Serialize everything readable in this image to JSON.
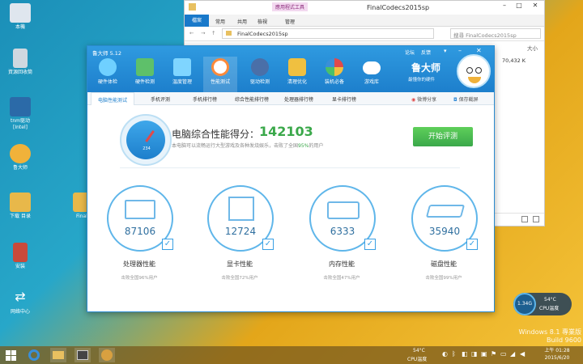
{
  "desktop": {
    "icons": [
      {
        "label": "本機",
        "color": "#dfe6ee"
      },
      {
        "label": "資源回收筒",
        "color": "#cfd8e0"
      },
      {
        "label": "tnm驱动\n[Intel]",
        "color": "#2b6aa8"
      },
      {
        "label": "鲁大师",
        "color": "#f0b23a"
      },
      {
        "label": "下载  目录",
        "color": "#e8b84a"
      },
      {
        "label": "FinalC",
        "color": "#e8b84a"
      },
      {
        "label": "安装",
        "color": "#c94a3a"
      },
      {
        "label": "网络中心",
        "color": "#e0e6ec"
      }
    ],
    "watermark": {
      "line1": "Windows 8.1 專業版",
      "line2": "Build 9600"
    }
  },
  "explorer": {
    "ribbon_context": "應用程式工具",
    "title": "FinalCodecs2015sp",
    "tabs": [
      "檔案",
      "常用",
      "共用",
      "檢視",
      "管理"
    ],
    "address": "FinalCodecs2015sp",
    "search_placeholder": "搜尋 FinalCodecs2015sp",
    "col_size": "大小",
    "size_value": "70,432 K"
  },
  "ludashi": {
    "title": "鲁大师 5.12",
    "controls": [
      "论坛",
      "反馈"
    ],
    "nav": [
      {
        "label": "硬件体检",
        "color": "#6fd0ff"
      },
      {
        "label": "硬件检测",
        "color": "#5ec06a"
      },
      {
        "label": "温度管理",
        "color": "#7fd5ff"
      },
      {
        "label": "性能测试",
        "color": "#ffffff"
      },
      {
        "label": "驱动检测",
        "color": "#4a6fa8"
      },
      {
        "label": "清理优化",
        "color": "#f0c040"
      },
      {
        "label": "装机必备",
        "color": "#e04a4a"
      },
      {
        "label": "游戏库",
        "color": "#ffffff"
      }
    ],
    "brand": {
      "name": "鲁大师",
      "slogan": "最懂你的硬件"
    },
    "tabs": [
      "电脑性能测试",
      "手机评测",
      "手机排行榜",
      "综合性能排行榜",
      "处理器排行榜",
      "显卡排行榜"
    ],
    "share_label": "微博分享",
    "save_label": "保存截屏",
    "score_label": "电脑综合性能得分：",
    "score_value": "142103",
    "score_desc_prefix": "本电脑可以流畅运行大型游戏及各种发烧娱乐，击败了全国",
    "score_percent": "95%",
    "score_desc_suffix": "的用户",
    "gauge_inner": "234",
    "start_button": "开始评测",
    "components": [
      {
        "title": "处理器性能",
        "value": "87106",
        "beat": "击败全国96%用户"
      },
      {
        "title": "显卡性能",
        "value": "12724",
        "beat": "击败全国72%用户"
      },
      {
        "title": "内存性能",
        "value": "6333",
        "beat": "击败全国47%用户"
      },
      {
        "title": "磁盘性能",
        "value": "35940",
        "beat": "击败全国99%用户"
      }
    ],
    "check_mark": "✓"
  },
  "widget": {
    "ring_value": "1.34G",
    "temp": "54°C",
    "label": "CPU温度"
  },
  "taskbar": {
    "apps": [
      {
        "name": "start-button",
        "color": "#ffffff"
      },
      {
        "name": "ie-app",
        "color": "#3a8fd8"
      },
      {
        "name": "explorer-app",
        "color": "#e8c060"
      },
      {
        "name": "media-app",
        "color": "#444444"
      },
      {
        "name": "ludashi-app",
        "color": "#d8a040"
      }
    ],
    "tray_temp": "54°C",
    "tray_temp_label": "CPU温度",
    "time": "上午 01:28",
    "date": "2015/6/20"
  }
}
